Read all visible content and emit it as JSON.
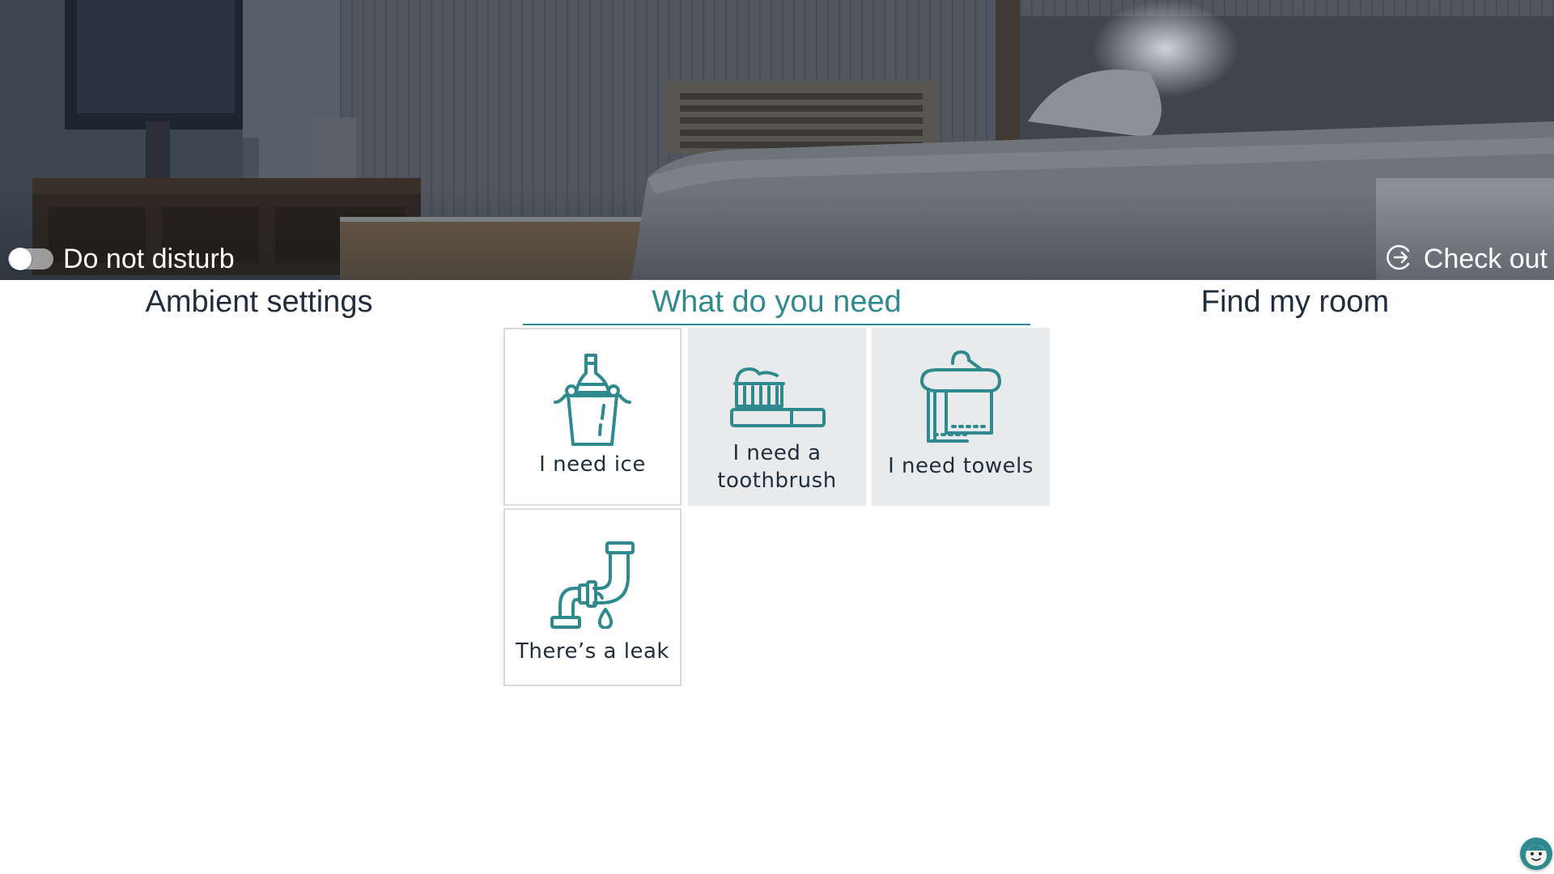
{
  "header": {
    "do_not_disturb": {
      "label": "Do not disturb",
      "enabled": false
    },
    "check_out": {
      "label": "Check out",
      "icon": "exit-arrow-icon"
    }
  },
  "tabs": [
    {
      "label": "Ambient settings",
      "active": false
    },
    {
      "label": "What do you need",
      "active": true
    },
    {
      "label": "Find my room",
      "active": false
    }
  ],
  "requests": [
    {
      "label": "I need ice",
      "icon": "ice-bucket-icon",
      "selected": false
    },
    {
      "label": "I need a toothbrush",
      "icon": "toothbrush-icon",
      "selected": true
    },
    {
      "label": "I need towels",
      "icon": "towels-icon",
      "selected": true
    },
    {
      "label": "There’s a leak",
      "icon": "leaking-pipe-icon",
      "selected": false
    }
  ],
  "chat": {
    "icon": "assistant-avatar-icon"
  },
  "colors": {
    "accent": "#2e8a8e",
    "text": "#1f2d3d",
    "tile_selected_bg": "#e9eaeb",
    "tile_border": "#d8dbde"
  }
}
